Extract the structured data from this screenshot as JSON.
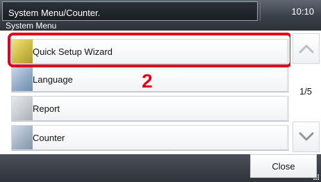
{
  "header": {
    "title": "System Menu/Counter.",
    "time": "10:10",
    "subtitle": "System Menu"
  },
  "menu": {
    "items": [
      {
        "label": "Quick Setup Wizard",
        "icon": "wizard-icon"
      },
      {
        "label": "Language",
        "icon": "language-icon"
      },
      {
        "label": "Report",
        "icon": "report-icon"
      },
      {
        "label": "Counter",
        "icon": "counter-icon"
      }
    ]
  },
  "annotation": {
    "step_number": "2",
    "highlight_color": "#e2001a"
  },
  "scroll": {
    "page_indicator": "1/5",
    "up_icon": "chevron-up-icon",
    "down_icon": "chevron-down-icon"
  },
  "footer": {
    "close_label": "Close"
  }
}
